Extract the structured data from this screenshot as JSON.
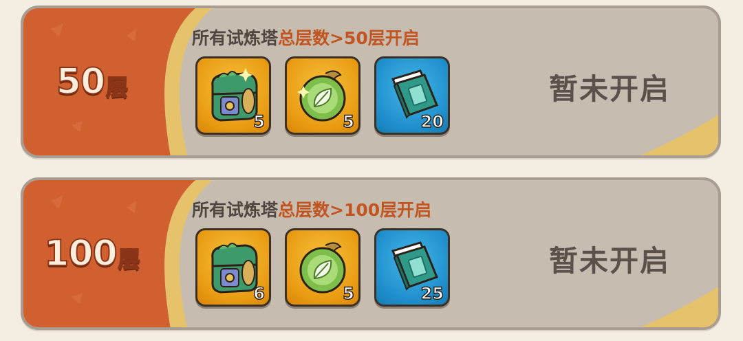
{
  "colors": {
    "card_bg": "#c7bcb0",
    "floor_bg": "#d0602f",
    "accent_stripe": "#e6c36b",
    "condition_text": "#4e463f",
    "condition_highlight": "#c2541f",
    "status_text": "#5a524a",
    "page_bg": "#f3ede2"
  },
  "rewards": [
    {
      "floor_number": "50",
      "floor_unit": "层",
      "condition_prefix": "所有试炼塔",
      "condition_highlight": "总层数>50层开启",
      "status": "暂未开启",
      "items": [
        {
          "icon": "treasure-chest-icon",
          "quantity": "5"
        },
        {
          "icon": "leaf-orb-icon",
          "quantity": "5"
        },
        {
          "icon": "skill-book-icon",
          "quantity": "20"
        }
      ]
    },
    {
      "floor_number": "100",
      "floor_unit": "层",
      "condition_prefix": "所有试炼塔",
      "condition_highlight": "总层数>100层开启",
      "status": "暂未开启",
      "items": [
        {
          "icon": "treasure-chest-icon",
          "quantity": "6"
        },
        {
          "icon": "leaf-orb-icon",
          "quantity": "5"
        },
        {
          "icon": "skill-book-icon",
          "quantity": "25"
        }
      ]
    }
  ]
}
